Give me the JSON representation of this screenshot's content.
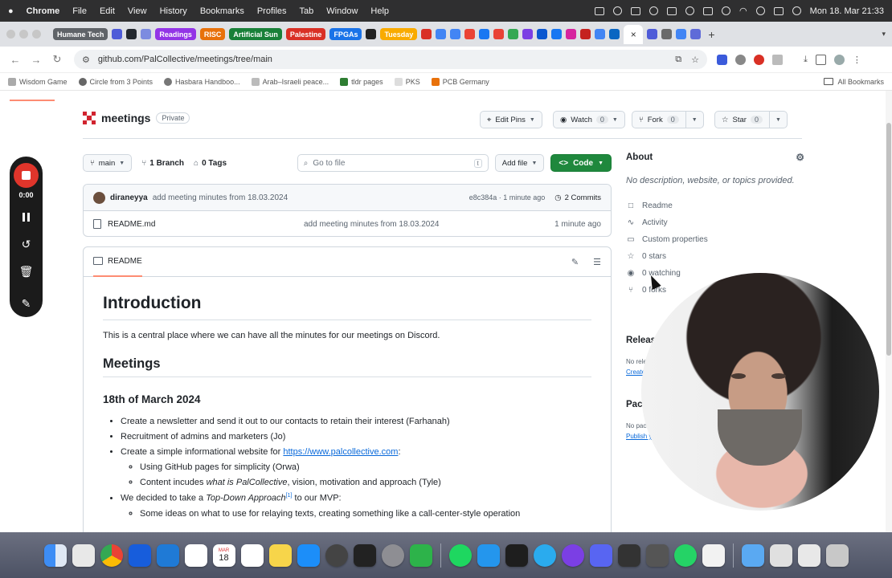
{
  "menubar": {
    "app": "Chrome",
    "items": [
      "File",
      "Edit",
      "View",
      "History",
      "Bookmarks",
      "Profiles",
      "Tab",
      "Window",
      "Help"
    ],
    "datetime": "Mon 18. Mar 21:33"
  },
  "tabs": {
    "labels": [
      {
        "text": "Humane Tech",
        "color": "#5f6368"
      },
      {
        "text": "Readings",
        "color": "#9334e6"
      },
      {
        "text": "RISC",
        "color": "#e8710a"
      },
      {
        "text": "Artificial Sun",
        "color": "#188038"
      },
      {
        "text": "Palestine",
        "color": "#d93025"
      },
      {
        "text": "FPGAs",
        "color": "#1a73e8"
      },
      {
        "text": "Tuesday",
        "color": "#f9ab00"
      }
    ],
    "active_close": "×",
    "new_tab": "+"
  },
  "address": {
    "url": "github.com/PalCollective/meetings/tree/main"
  },
  "bookmarks": {
    "items": [
      "Wisdom Game",
      "Circle from 3 Points",
      "Hasbara Handboo...",
      "Arab–Israeli peace...",
      "tldr pages",
      "PKS",
      "PCB Germany"
    ],
    "all": "All Bookmarks"
  },
  "repo": {
    "name": "meetings",
    "visibility": "Private",
    "edit_pins": "Edit Pins",
    "watch": "Watch",
    "watch_count": "0",
    "fork": "Fork",
    "fork_count": "0",
    "star": "Star",
    "star_count": "0"
  },
  "toolbar": {
    "branch": "main",
    "branches": "1 Branch",
    "tags": "0 Tags",
    "go_to_file": "Go to file",
    "shortcut": "t",
    "add_file": "Add file",
    "code": "Code"
  },
  "commit": {
    "author": "diraneyya",
    "message": "add meeting minutes from 18.03.2024",
    "hash_time": "e8c384a · 1 minute ago",
    "commits": "2 Commits"
  },
  "files": [
    {
      "name": "README.md",
      "message": "add meeting minutes from 18.03.2024",
      "age": "1 minute ago"
    }
  ],
  "readme": {
    "tab": "README",
    "h1": "Introduction",
    "intro": "This is a central place where we can have all the minutes for our meetings on Discord.",
    "h2": "Meetings",
    "h3": "18th of March 2024",
    "li1": "Create a newsletter and send it out to our contacts to retain their interest (Farhanah)",
    "li2": "Recruitment of admins and marketers (Jo)",
    "li3_prefix": "Create a simple informational website for ",
    "li3_link": "https://www.palcollective.com",
    "li3_suffix": ":",
    "li3_sub1": "Using GitHub pages for simplicity (Orwa)",
    "li3_sub2_pre": "Content incudes ",
    "li3_sub2_em": "what is PalCollective",
    "li3_sub2_post": ", vision, motivation and approach (Tyle)",
    "li4_pre": "We decided to take a ",
    "li4_em": "Top-Down Approach",
    "li4_sup": "[1]",
    "li4_post": " to our MVP:",
    "li4_sub1": "Some ideas on what to use for relaying texts, creating something like a call-center-style operation"
  },
  "about": {
    "title": "About",
    "description": "No description, website, or topics provided.",
    "items": [
      "Readme",
      "Activity",
      "Custom properties",
      "0 stars",
      "0 watching",
      "0 forks"
    ],
    "releases": "Releases",
    "releases_note": "No releases published",
    "releases_link": "Create a new release",
    "packages": "Packages",
    "packages_note": "No packages published",
    "packages_link": "Publish your first package"
  },
  "recorder": {
    "time": "0:00"
  },
  "dock_calendar": {
    "month": "MAR",
    "day": "18"
  }
}
